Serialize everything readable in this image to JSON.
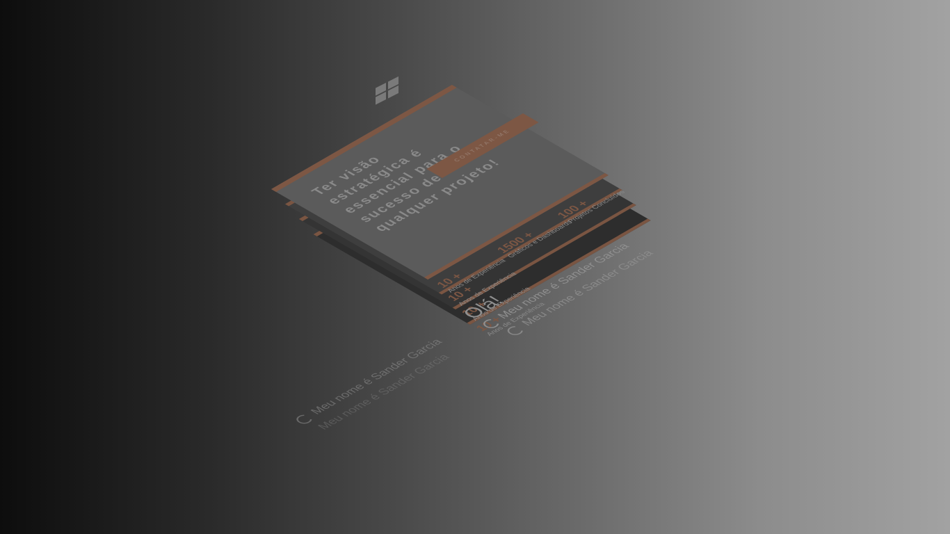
{
  "logo": {
    "icon": "windows-logo-icon"
  },
  "hero": {
    "title": "Ter visão estratégica é essencial para o sucesso de qualquer projeto!",
    "cta_label": "CONTATAR-ME"
  },
  "stats": [
    {
      "value": "10 +",
      "label": "Anos de Experiência"
    },
    {
      "value": "1500 +",
      "label": "Gráficos e Dashboards"
    },
    {
      "value": "100 +",
      "label": "Projetos Concluídos"
    }
  ],
  "ghost_stats": [
    {
      "value": "10 +",
      "label": "Anos de Experiência"
    },
    {
      "value": "10 +",
      "label": "Anos de Experiência"
    },
    {
      "value": "10 +",
      "label": "Anos de Experiência"
    }
  ],
  "intro": {
    "greeting": "Olá!",
    "lines": [
      "Meu nome é Sander Garcia",
      "Meu nome é Sander Garcia",
      "Meu nome é Sander Garcia",
      "Meu nome é Sander Garcia"
    ]
  },
  "colors": {
    "accent": "#7d5744"
  }
}
